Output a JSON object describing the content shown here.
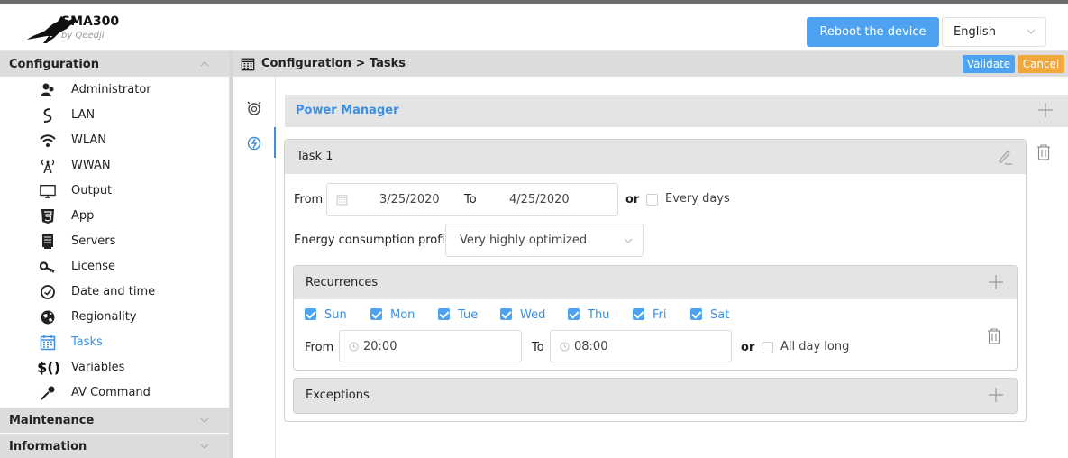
{
  "header": {
    "app_name": "SMA300",
    "app_sub": "by Qeedji",
    "reboot_label": "Reboot the device",
    "language": "English"
  },
  "sidebar": {
    "configuration_label": "Configuration",
    "items": [
      {
        "label": "Administrator",
        "icon": "administrator-icon"
      },
      {
        "label": "LAN",
        "icon": "lan-icon"
      },
      {
        "label": "WLAN",
        "icon": "wifi-icon"
      },
      {
        "label": "WWAN",
        "icon": "antenna-icon"
      },
      {
        "label": "Output",
        "icon": "monitor-icon"
      },
      {
        "label": "App",
        "icon": "html5-icon"
      },
      {
        "label": "Servers",
        "icon": "server-icon"
      },
      {
        "label": "License",
        "icon": "key-icon"
      },
      {
        "label": "Date and time",
        "icon": "clock-icon"
      },
      {
        "label": "Regionality",
        "icon": "globe-icon"
      },
      {
        "label": "Tasks",
        "icon": "calendar-icon"
      },
      {
        "label": "Variables",
        "icon": "variables-icon"
      },
      {
        "label": "AV Command",
        "icon": "microphone-icon"
      }
    ],
    "active_item": "Tasks",
    "maintenance_label": "Maintenance",
    "information_label": "Information"
  },
  "main": {
    "breadcrumb": "Configuration > Tasks",
    "validate_label": "Validate",
    "cancel_label": "Cancel",
    "power_manager_label": "Power Manager",
    "task": {
      "title": "Task 1",
      "from_label": "From",
      "from_date": "3/25/2020",
      "to_label": "To",
      "to_date": "4/25/2020",
      "or_label": "or",
      "every_days_label": "Every days",
      "every_days_checked": false,
      "energy_label": "Energy consumption profile",
      "energy_value": "Very highly optimized",
      "recurrences": {
        "title": "Recurrences",
        "days": [
          {
            "label": "Sun",
            "checked": true
          },
          {
            "label": "Mon",
            "checked": true
          },
          {
            "label": "Tue",
            "checked": true
          },
          {
            "label": "Wed",
            "checked": true
          },
          {
            "label": "Thu",
            "checked": true
          },
          {
            "label": "Fri",
            "checked": true
          },
          {
            "label": "Sat",
            "checked": true
          }
        ],
        "from_label": "From",
        "from_time": "20:00",
        "to_label": "To",
        "to_time": "08:00",
        "or_label": "or",
        "all_day_label": "All day long",
        "all_day_checked": false
      },
      "exceptions_title": "Exceptions"
    }
  },
  "colors": {
    "accent": "#4da3f2",
    "link": "#3d8fe0",
    "cancel": "#f0a83a",
    "header_grey": "#dcdcdc"
  }
}
